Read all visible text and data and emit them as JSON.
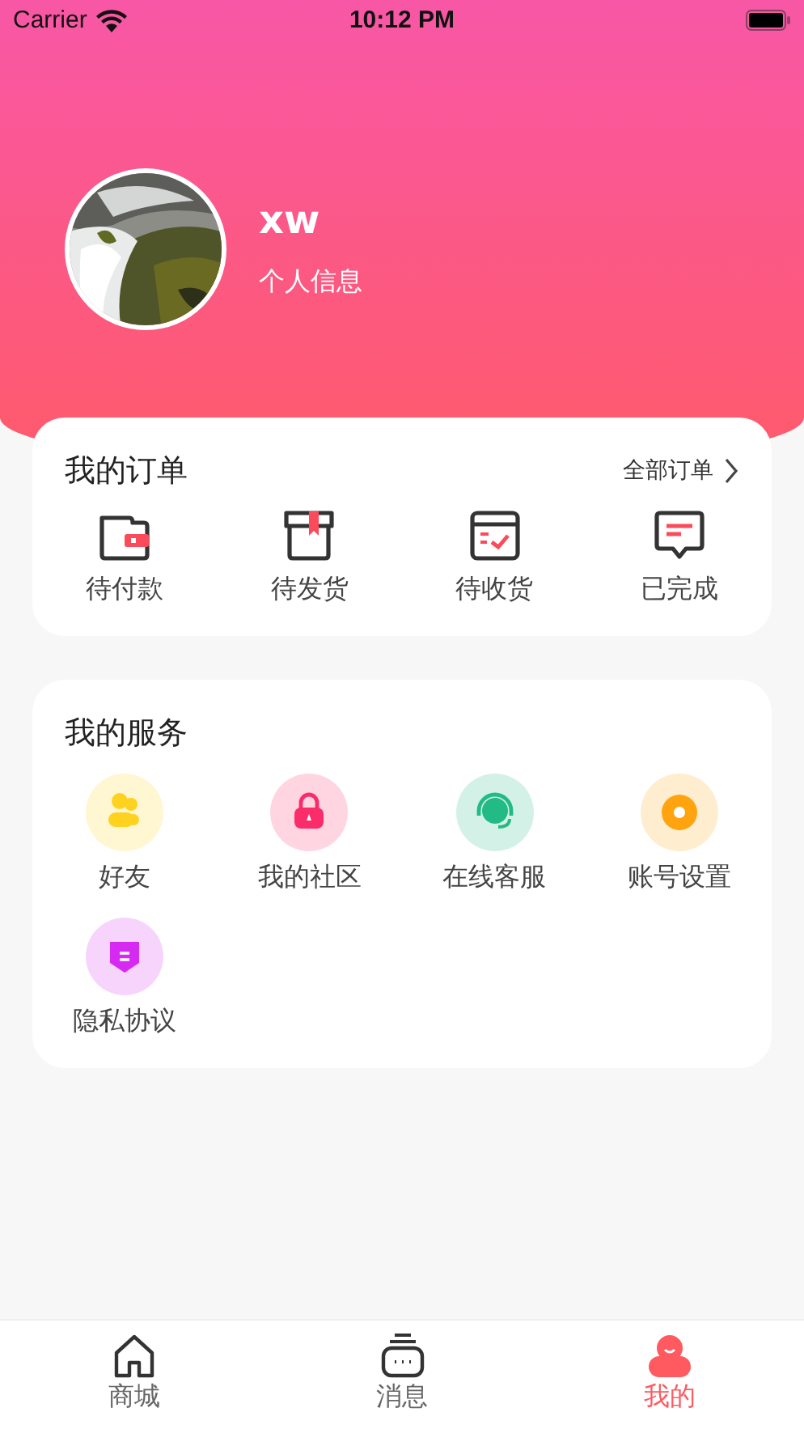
{
  "status_bar": {
    "carrier": "Carrier",
    "time": "10:12 PM"
  },
  "profile": {
    "name": "xw",
    "subtitle": "个人信息"
  },
  "orders": {
    "title": "我的订单",
    "link": "全部订单",
    "items": [
      {
        "kind": "wallet",
        "label": "待付款"
      },
      {
        "kind": "box",
        "label": "待发货"
      },
      {
        "kind": "receipt",
        "label": "待收货"
      },
      {
        "kind": "message",
        "label": "已完成"
      }
    ]
  },
  "services": {
    "title": "我的服务",
    "items": [
      {
        "kind": "friends",
        "label": "好友",
        "color": "#ffd21f"
      },
      {
        "kind": "lock",
        "label": "我的社区",
        "color": "#fb2c6a"
      },
      {
        "kind": "headset",
        "label": "在线客服",
        "color": "#22bb85"
      },
      {
        "kind": "gear",
        "label": "账号设置",
        "color": "#ffa40f"
      },
      {
        "kind": "shield",
        "label": "隐私协议",
        "color": "#d629f2"
      }
    ]
  },
  "tab_bar": [
    {
      "kind": "home",
      "label": "商城",
      "selected": false
    },
    {
      "kind": "chat",
      "label": "消息",
      "selected": false
    },
    {
      "kind": "person",
      "label": "我的",
      "selected": true
    }
  ]
}
